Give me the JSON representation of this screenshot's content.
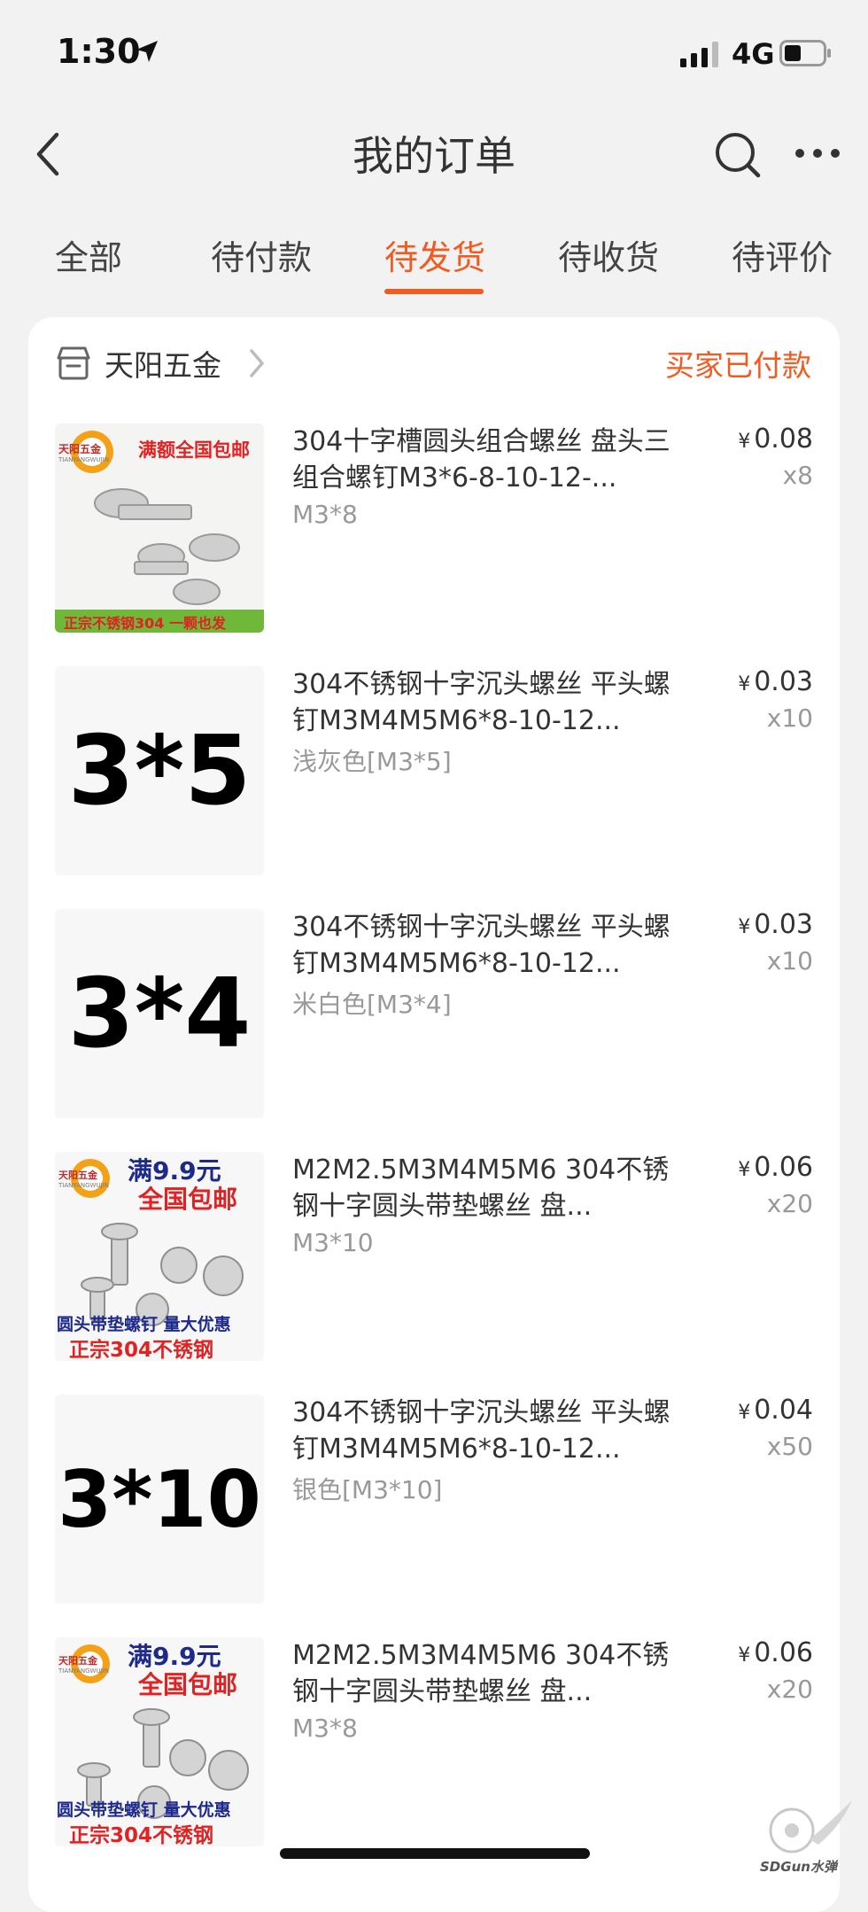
{
  "status_bar": {
    "time": "1:30",
    "network": "4G"
  },
  "header": {
    "title": "我的订单"
  },
  "tabs": [
    {
      "label": "全部",
      "active": false
    },
    {
      "label": "待付款",
      "active": false
    },
    {
      "label": "待发货",
      "active": true
    },
    {
      "label": "待收货",
      "active": false
    },
    {
      "label": "待评价",
      "active": false
    }
  ],
  "order": {
    "shop_name": "天阳五金",
    "status": "买家已付款",
    "items": [
      {
        "name": "304十字槽圆头组合螺丝 盘头三组合螺钉M3*6-8-10-12-...",
        "spec": "M3*8",
        "currency": "¥",
        "price": "0.08",
        "qty": "x8",
        "thumb": {
          "type": "photo",
          "brand": "天阳五金",
          "brand_en": "TIANYANGWUJIN",
          "promo": "满额全国包邮",
          "footer": "正宗不锈钢304 一颗也发"
        }
      },
      {
        "name": "304不锈钢十字沉头螺丝 平头螺钉M3M4M5M6*8-10-12...",
        "spec": "浅灰色[M3*5]",
        "currency": "¥",
        "price": "0.03",
        "qty": "x10",
        "thumb": {
          "type": "text",
          "label": "3*5"
        }
      },
      {
        "name": "304不锈钢十字沉头螺丝 平头螺钉M3M4M5M6*8-10-12...",
        "spec": "米白色[M3*4]",
        "currency": "¥",
        "price": "0.03",
        "qty": "x10",
        "thumb": {
          "type": "text",
          "label": "3*4"
        }
      },
      {
        "name": "M2M2.5M3M4M5M6 304不锈钢十字圆头带垫螺丝 盘...",
        "spec": "M3*10",
        "currency": "¥",
        "price": "0.06",
        "qty": "x20",
        "thumb": {
          "type": "photo2",
          "brand": "天阳五金",
          "brand_en": "TIANYANGWUJIN",
          "promo1": "满9.9元",
          "promo2": "全国包邮",
          "line1": "圆头带垫螺钉 量大优惠",
          "line2": "正宗304不锈钢"
        }
      },
      {
        "name": "304不锈钢十字沉头螺丝 平头螺钉M3M4M5M6*8-10-12...",
        "spec": "银色[M3*10]",
        "currency": "¥",
        "price": "0.04",
        "qty": "x50",
        "thumb": {
          "type": "text",
          "label": "3*10"
        }
      },
      {
        "name": "M2M2.5M3M4M5M6 304不锈钢十字圆头带垫螺丝 盘...",
        "spec": "M3*8",
        "currency": "¥",
        "price": "0.06",
        "qty": "x20",
        "thumb": {
          "type": "photo2",
          "brand": "天阳五金",
          "brand_en": "TIANYANGWUJIN",
          "promo1": "满9.9元",
          "promo2": "全国包邮",
          "line1": "圆头带垫螺钉 量大优惠",
          "line2": "正宗304不锈钢"
        }
      }
    ]
  },
  "watermark": {
    "text": "SDGun水弹"
  },
  "colors": {
    "accent": "#f25a1f",
    "background": "#f2f2f2"
  }
}
